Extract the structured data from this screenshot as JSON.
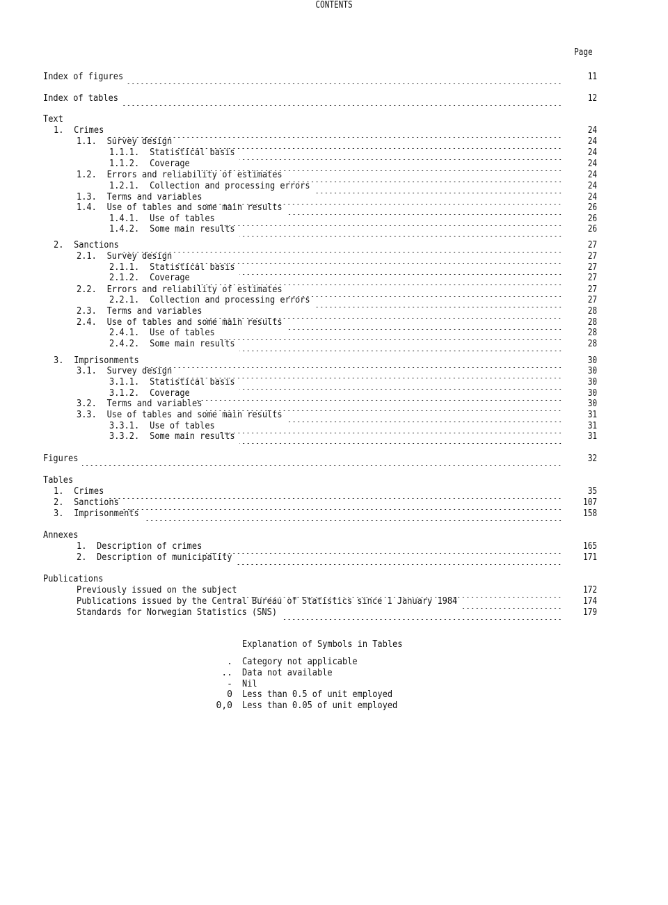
{
  "document": {
    "title": "CONTENTS",
    "page_column_header": "Page"
  },
  "top_entries": [
    {
      "label": "Index of figures",
      "page": "11"
    },
    {
      "label": "Index of tables",
      "page": "12"
    }
  ],
  "text_section": {
    "heading": "Text",
    "entries": [
      {
        "num": "1.",
        "label": "Crimes",
        "page": "24",
        "level": 1
      },
      {
        "num": "1.1.",
        "label": "Survey design",
        "page": "24",
        "level": 2
      },
      {
        "num": "1.1.1.",
        "label": "Statistical basis",
        "page": "24",
        "level": 3
      },
      {
        "num": "1.1.2.",
        "label": "Coverage",
        "page": "24",
        "level": 3
      },
      {
        "num": "1.2.",
        "label": "Errors and reliability of estimates",
        "page": "24",
        "level": 2
      },
      {
        "num": "1.2.1.",
        "label": "Collection and processing errors",
        "page": "24",
        "level": 3
      },
      {
        "num": "1.3.",
        "label": "Terms and variables",
        "page": "24",
        "level": 2
      },
      {
        "num": "1.4.",
        "label": "Use of tables and some main results",
        "page": "26",
        "level": 2
      },
      {
        "num": "1.4.1.",
        "label": "Use of tables",
        "page": "26",
        "level": 3
      },
      {
        "num": "1.4.2.",
        "label": "Some main results",
        "page": "26",
        "level": 3
      },
      {
        "num": "2.",
        "label": "Sanctions",
        "page": "27",
        "level": 1
      },
      {
        "num": "2.1.",
        "label": "Survey design",
        "page": "27",
        "level": 2
      },
      {
        "num": "2.1.1.",
        "label": "Statistical basis",
        "page": "27",
        "level": 3
      },
      {
        "num": "2.1.2.",
        "label": "Coverage",
        "page": "27",
        "level": 3
      },
      {
        "num": "2.2.",
        "label": "Errors and reliability of estimates",
        "page": "27",
        "level": 2
      },
      {
        "num": "2.2.1.",
        "label": "Collection and processing errors",
        "page": "27",
        "level": 3
      },
      {
        "num": "2.3.",
        "label": "Terms and variables",
        "page": "28",
        "level": 2
      },
      {
        "num": "2.4.",
        "label": "Use of tables and some main results",
        "page": "28",
        "level": 2
      },
      {
        "num": "2.4.1.",
        "label": "Use of tables",
        "page": "28",
        "level": 3
      },
      {
        "num": "2.4.2.",
        "label": "Some main results",
        "page": "28",
        "level": 3
      },
      {
        "num": "3.",
        "label": "Imprisonments",
        "page": "30",
        "level": 1
      },
      {
        "num": "3.1.",
        "label": "Survey design",
        "page": "30",
        "level": 2
      },
      {
        "num": "3.1.1.",
        "label": "Statistical basis",
        "page": "30",
        "level": 3
      },
      {
        "num": "3.1.2.",
        "label": "Coverage",
        "page": "30",
        "level": 3
      },
      {
        "num": "3.2.",
        "label": "Terms and variables",
        "page": "30",
        "level": 2
      },
      {
        "num": "3.3.",
        "label": "Use of tables and some main results",
        "page": "31",
        "level": 2
      },
      {
        "num": "3.3.1.",
        "label": "Use of tables",
        "page": "31",
        "level": 3
      },
      {
        "num": "3.3.2.",
        "label": "Some main results",
        "page": "31",
        "level": 3
      }
    ]
  },
  "figures_entry": {
    "label": "Figures",
    "page": "32"
  },
  "tables_section": {
    "heading": "Tables",
    "entries": [
      {
        "num": "1.",
        "label": "Crimes",
        "page": "35"
      },
      {
        "num": "2.",
        "label": "Sanctions",
        "page": "107"
      },
      {
        "num": "3.",
        "label": "Imprisonments",
        "page": "158"
      }
    ]
  },
  "annexes_section": {
    "heading": "Annexes",
    "entries": [
      {
        "num": "1.",
        "label": "Description of crimes",
        "page": "165"
      },
      {
        "num": "2.",
        "label": "Description of municipality",
        "page": "171"
      }
    ]
  },
  "publications_section": {
    "heading": "Publications",
    "entries": [
      {
        "label": "Previously issued on the subject",
        "page": "172"
      },
      {
        "label": "Publications issued by the Central Bureau of Statistics since 1 January 1984",
        "page": "174"
      },
      {
        "label": "Standards for Norwegian Statistics (SNS)",
        "page": "179"
      }
    ]
  },
  "symbols_legend": {
    "title": "Explanation of Symbols in Tables",
    "items": [
      {
        "symbol": ".",
        "meaning": "Category not applicable"
      },
      {
        "symbol": "..",
        "meaning": "Data not available"
      },
      {
        "symbol": "-",
        "meaning": "Nil"
      },
      {
        "symbol": "0",
        "meaning": "Less than 0.5 of unit employed"
      },
      {
        "symbol": "0,0",
        "meaning": "Less than 0.05 of unit employed"
      }
    ]
  }
}
